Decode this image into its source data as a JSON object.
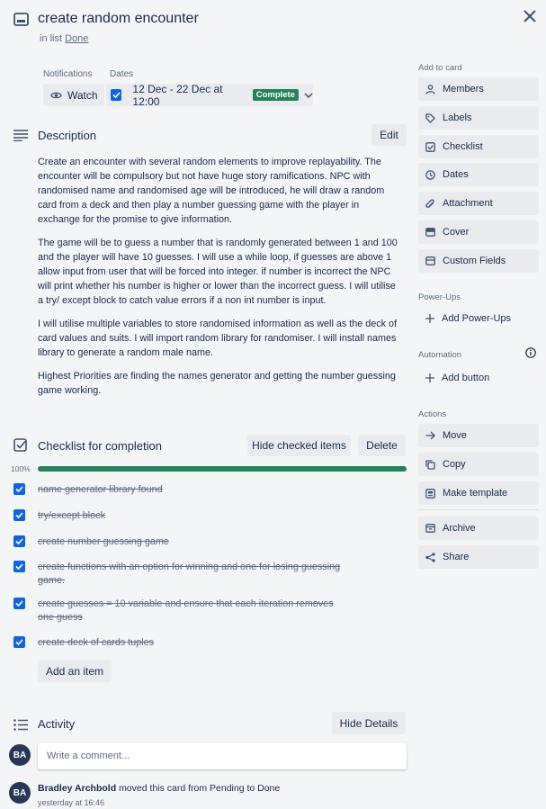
{
  "card": {
    "title": "create random encounter",
    "in_list_prefix": "in list",
    "list_name": "Done"
  },
  "meta": {
    "notifications_label": "Notifications",
    "watch_label": "Watch",
    "dates_label": "Dates",
    "dates_value": "12 Dec - 22 Dec at 12:00",
    "status_badge": "Complete"
  },
  "description": {
    "heading": "Description",
    "edit_label": "Edit",
    "paragraphs": [
      "Create an encounter with several random elements to improve replayability. The encounter will be compulsory but not have huge story ramifications. NPC with randomised name and randomised age will be introduced, he will draw a random card from a deck and then play a number guessing game with the player in exchange for the promise to give information.",
      "The game will be to guess a number that is randomly generated between 1 and 100 and the player will have 10 guesses. I will use a while loop, if guesses are above 1 allow input from user that will be forced into integer. if number is incorrect the NPC will print whether his number is higher or lower than the incorrect guess. I will utilise a try/ except block to catch value errors if a non int number is input.",
      "I will utilise multiple variables to store randomised information as well as the deck of card values and suits. I will import random library for randomiser. I will install names library to generate a random male name.",
      "Highest Priorities are finding the names generator and getting the number guessing game working."
    ]
  },
  "checklist": {
    "heading": "Checklist for completion",
    "hide_checked_label": "Hide checked items",
    "delete_label": "Delete",
    "progress_text": "100%",
    "progress_value": 1.0,
    "items": [
      "name generator library found",
      "try/except block",
      "create number guessing game",
      "create functions with an option for winning and one for losing guessing game.",
      "create guesses = 10 variable and ensure that each iteration removes one guess",
      "create deck of cards tuples"
    ],
    "add_item_label": "Add an item"
  },
  "activity": {
    "heading": "Activity",
    "hide_details_label": "Hide Details",
    "comment_placeholder": "Write a comment...",
    "avatar_initials": "BA",
    "entry": {
      "user": "Bradley Archbold",
      "action": "moved this card from Pending to Done",
      "time": "yesterday at 16:46"
    }
  },
  "sidebar": {
    "add_to_card_label": "Add to card",
    "add_to_card": [
      "Members",
      "Labels",
      "Checklist",
      "Dates",
      "Attachment",
      "Cover",
      "Custom Fields"
    ],
    "powerups_label": "Power-Ups",
    "add_powerups": "Add Power-Ups",
    "automation_label": "Automation",
    "add_button": "Add button",
    "actions_label": "Actions",
    "actions": [
      "Move",
      "Copy",
      "Make template"
    ],
    "actions2": [
      "Archive",
      "Share"
    ]
  },
  "colors": {
    "accent": "#0c66e4",
    "complete_badge": "#1f845a",
    "background": "#f4f5f7"
  }
}
